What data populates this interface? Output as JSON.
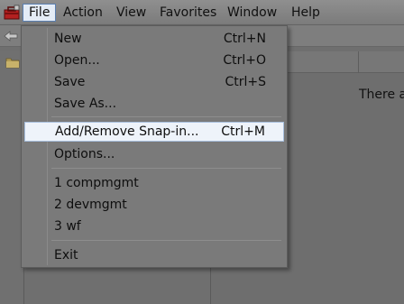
{
  "menubar": {
    "items": [
      {
        "label": "File"
      },
      {
        "label": "Action"
      },
      {
        "label": "View"
      },
      {
        "label": "Favorites"
      },
      {
        "label": "Window"
      },
      {
        "label": "Help"
      }
    ]
  },
  "content": {
    "message": "There a"
  },
  "file_menu": {
    "new": {
      "label": "New",
      "shortcut": "Ctrl+N"
    },
    "open": {
      "label": "Open...",
      "shortcut": "Ctrl+O"
    },
    "save": {
      "label": "Save",
      "shortcut": "Ctrl+S"
    },
    "save_as": {
      "label": "Save As..."
    },
    "add_remove": {
      "label": "Add/Remove Snap-in...",
      "shortcut": "Ctrl+M"
    },
    "options": {
      "label": "Options..."
    },
    "recent_1": {
      "label": "1 compmgmt"
    },
    "recent_2": {
      "label": "2 devmgmt"
    },
    "recent_3": {
      "label": "3 wf"
    },
    "exit": {
      "label": "Exit"
    }
  },
  "icons": {
    "app": "mmc-toolbox-icon",
    "back": "back-arrow-icon",
    "folder": "folder-icon"
  },
  "colors": {
    "highlight_bg": "#eef3fa",
    "highlight_border": "#a8c0de",
    "active_menu_border": "#5b7fb0"
  }
}
